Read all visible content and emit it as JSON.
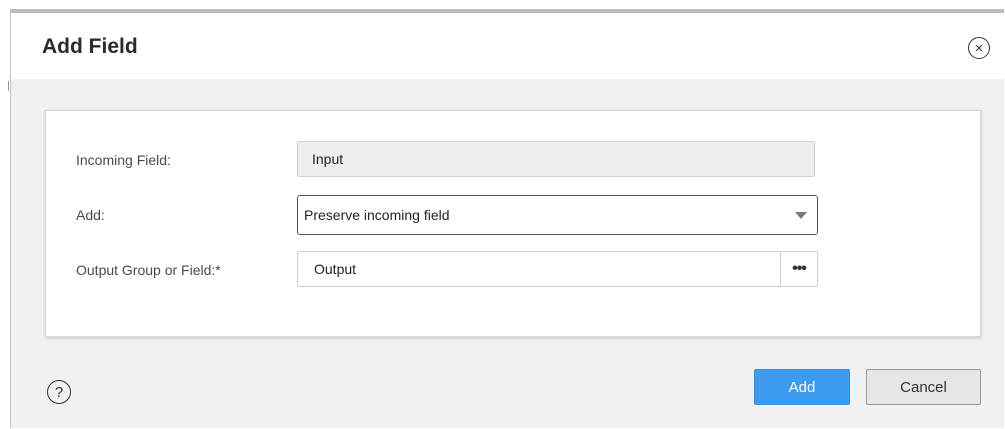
{
  "dialog": {
    "title": "Add Field",
    "close_icon": "close-circle-icon",
    "help_icon": "question-circle-icon"
  },
  "form": {
    "incoming_field": {
      "label": "Incoming Field:",
      "value": "Input"
    },
    "add": {
      "label": "Add:",
      "value": "Preserve incoming field"
    },
    "output": {
      "label": "Output Group or Field:",
      "required_mark": "*",
      "value": "Output",
      "picker_label": "•••"
    }
  },
  "buttons": {
    "add": "Add",
    "cancel": "Cancel"
  },
  "colors": {
    "primary": "#3c9aef",
    "required": "#d0021b"
  }
}
